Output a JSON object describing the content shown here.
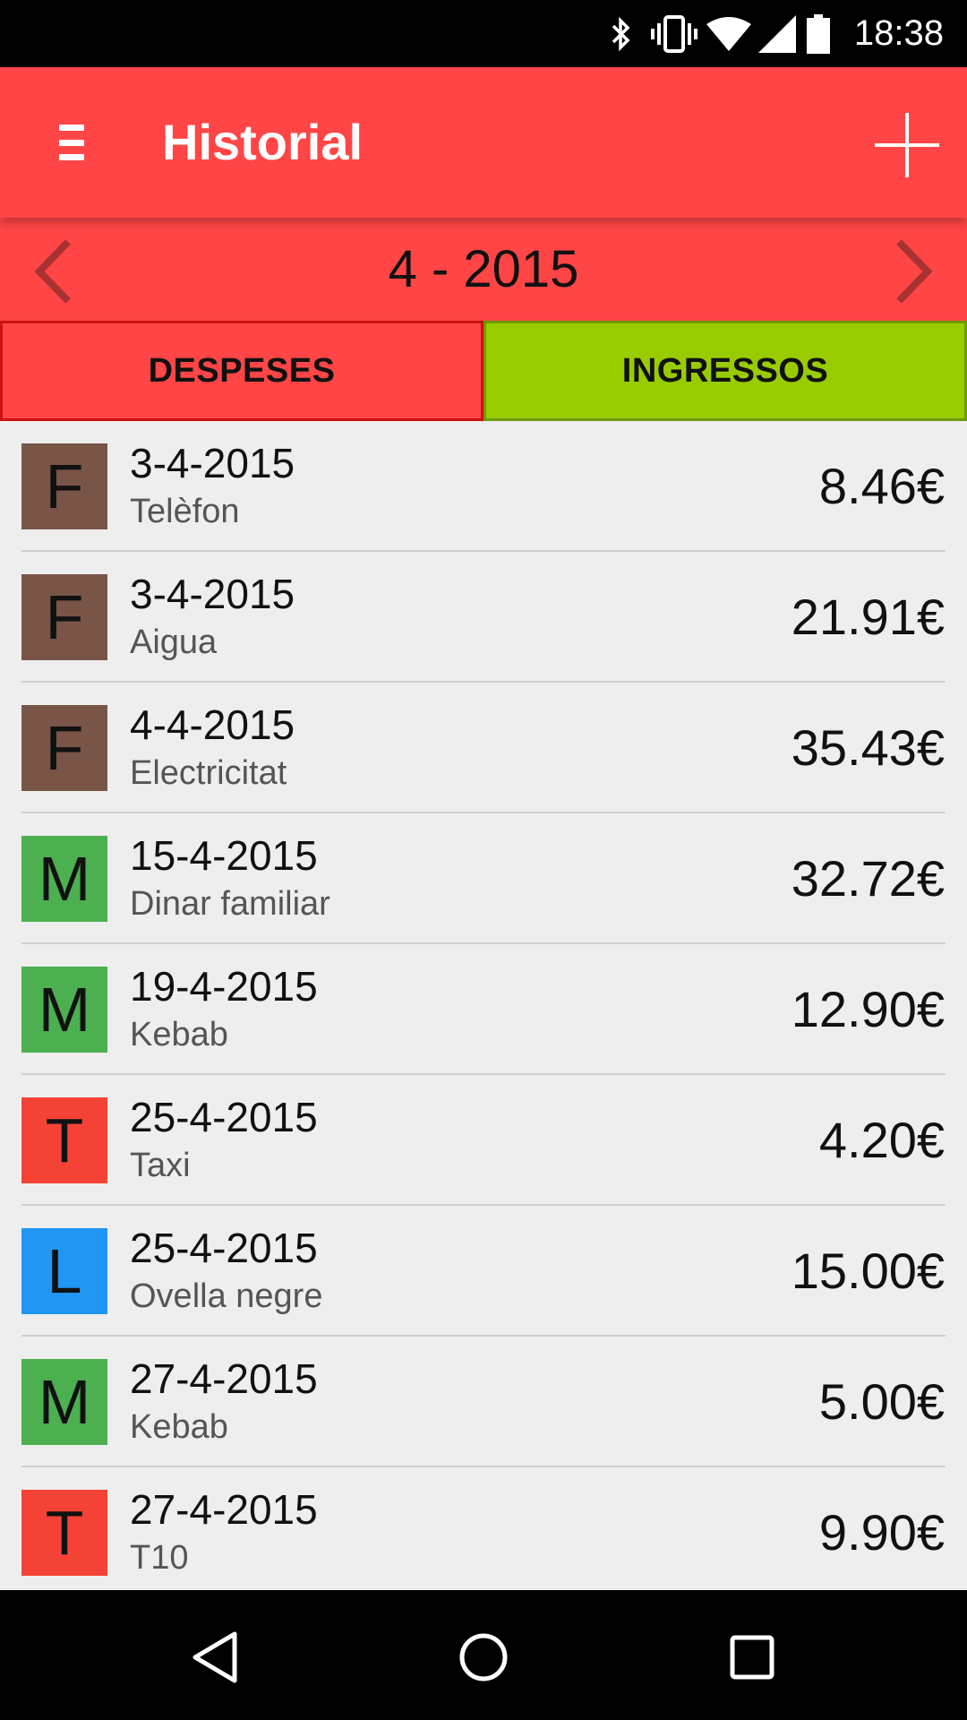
{
  "status_bar": {
    "time": "18:38",
    "icons": [
      "bluetooth-icon",
      "vibrate-icon",
      "wifi-icon",
      "signal-icon",
      "battery-icon"
    ]
  },
  "toolbar": {
    "title": "Historial",
    "menu_icon": "hamburger-menu-icon",
    "add_icon": "plus-icon"
  },
  "month_nav": {
    "label": "4 - 2015",
    "prev_icon": "chevron-left-icon",
    "next_icon": "chevron-right-icon"
  },
  "tabs": [
    {
      "label": "DESPESES",
      "color": "#ff4545",
      "selected": true
    },
    {
      "label": "INGRESSOS",
      "color": "#99cc00",
      "selected": false
    }
  ],
  "transactions": [
    {
      "letter": "F",
      "color": "#795548",
      "date": "3-4-2015",
      "description": "Telèfon",
      "amount": "8.46€"
    },
    {
      "letter": "F",
      "color": "#795548",
      "date": "3-4-2015",
      "description": "Aigua",
      "amount": "21.91€"
    },
    {
      "letter": "F",
      "color": "#795548",
      "date": "4-4-2015",
      "description": "Electricitat",
      "amount": "35.43€"
    },
    {
      "letter": "M",
      "color": "#4caf50",
      "date": "15-4-2015",
      "description": "Dinar familiar",
      "amount": "32.72€"
    },
    {
      "letter": "M",
      "color": "#4caf50",
      "date": "19-4-2015",
      "description": "Kebab",
      "amount": "12.90€"
    },
    {
      "letter": "T",
      "color": "#f44336",
      "date": "25-4-2015",
      "description": "Taxi",
      "amount": "4.20€"
    },
    {
      "letter": "L",
      "color": "#2196f3",
      "date": "25-4-2015",
      "description": "Ovella negre",
      "amount": "15.00€"
    },
    {
      "letter": "M",
      "color": "#4caf50",
      "date": "27-4-2015",
      "description": "Kebab",
      "amount": "5.00€"
    },
    {
      "letter": "T",
      "color": "#f44336",
      "date": "27-4-2015",
      "description": "T10",
      "amount": "9.90€"
    }
  ],
  "nav_bar": {
    "icons": [
      "back-icon",
      "home-icon",
      "recents-icon"
    ]
  },
  "colors": {
    "primary": "#ff4545",
    "income": "#99cc00",
    "background": "#eeeeee"
  }
}
